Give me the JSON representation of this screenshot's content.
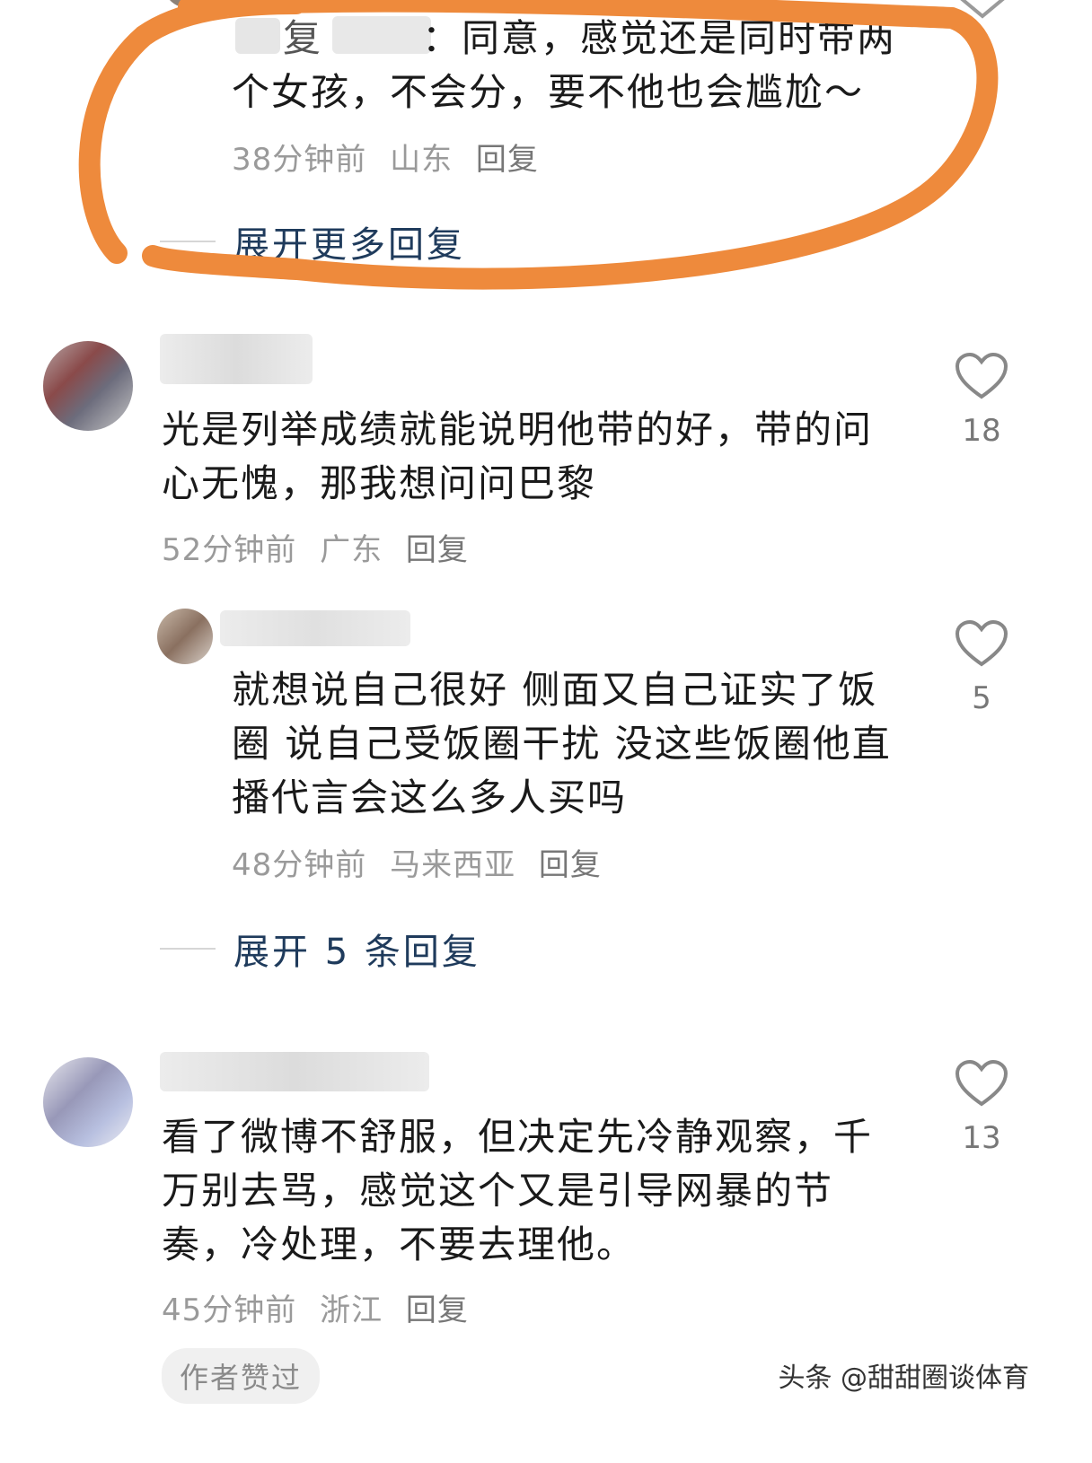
{
  "top_reply": {
    "username_prefix": "复",
    "text_partial": "：同意，感觉还是同时带两",
    "text_line2": "个女孩，不会分，要不他也会尴尬～",
    "time": "38分钟前",
    "location": "山东",
    "reply_label": "回复"
  },
  "expand_more_1": "展开更多回复",
  "comment1": {
    "text_line1": "光是列举成绩就能说明他带的好，带的问",
    "text_line2": "心无愧，那我想问问巴黎",
    "time": "52分钟前",
    "location": "广东",
    "reply_label": "回复",
    "likes": "18"
  },
  "reply1": {
    "text_line1": "就想说自己很好 侧面又自己证实了饭",
    "text_line2": "圈 说自己受饭圈干扰 没这些饭圈他直",
    "text_line3": "播代言会这么多人买吗",
    "time": "48分钟前",
    "location": "马来西亚",
    "reply_label": "回复",
    "likes": "5"
  },
  "expand_more_2": "展开 5 条回复",
  "comment2": {
    "text_line1": "看了微博不舒服，但决定先冷静观察，千",
    "text_line2": "万别去骂，感觉这个又是引导网暴的节",
    "text_line3": "奏，冷处理，不要去理他。",
    "time": "45分钟前",
    "location": "浙江",
    "reply_label": "回复",
    "likes": "13",
    "author_badge": "作者赞过"
  },
  "watermark": "头条 @甜甜圈谈体育",
  "colors": {
    "highlight_circle": "#ee8a3c",
    "expand_link": "#1f3b5c",
    "meta_text": "#9a9a9a"
  }
}
